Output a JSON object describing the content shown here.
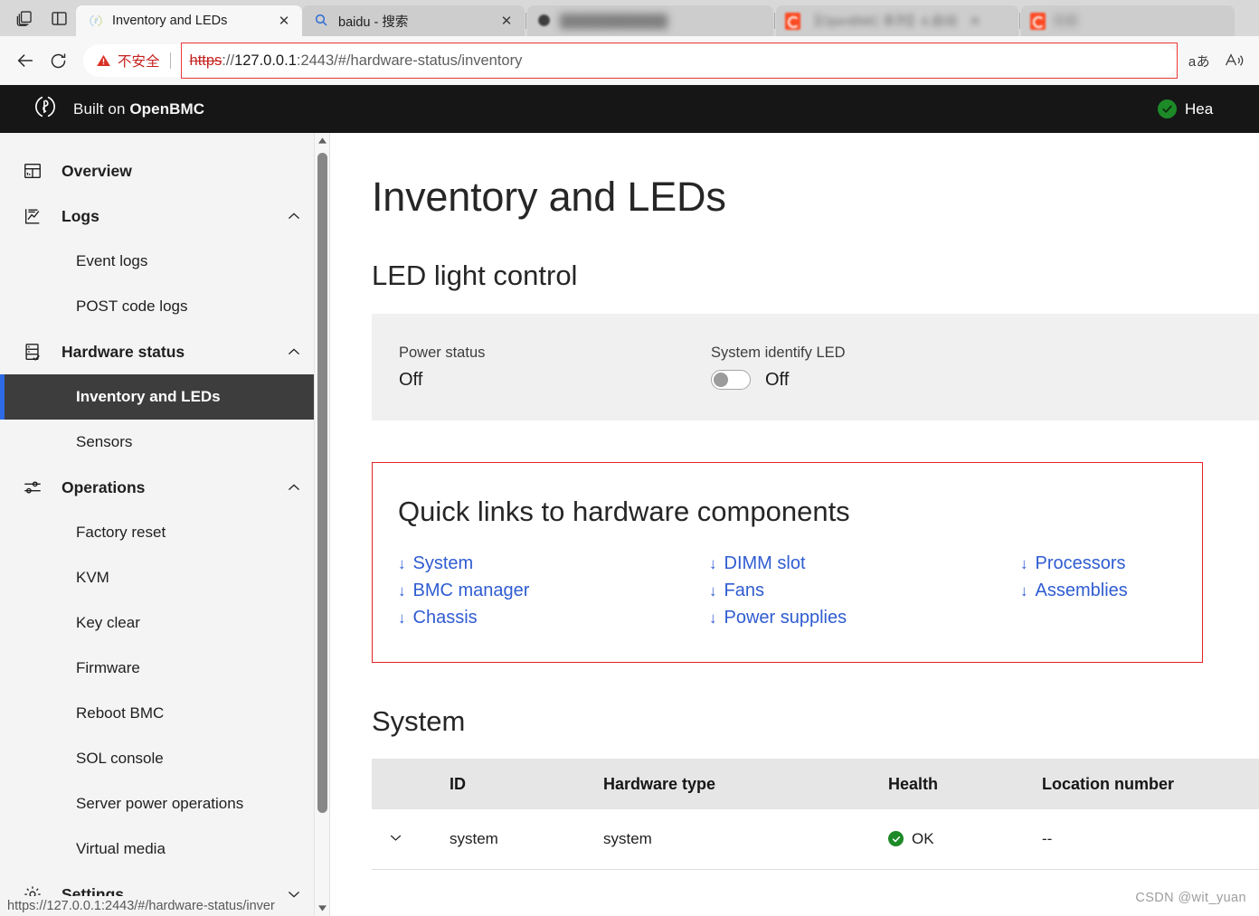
{
  "browser": {
    "chrome_buttons": [
      {
        "name": "tab-actions-icon"
      },
      {
        "name": "split-screen-icon"
      }
    ],
    "tabs": [
      {
        "title": "Inventory and LEDs",
        "favicon": "openbmc-icon",
        "active": true,
        "close_label": "✕"
      },
      {
        "title": "baidu - 搜索",
        "favicon": "search-icon",
        "active": false,
        "close_label": "✕"
      },
      {
        "title": "【OpenBMC 系列】4.启动",
        "favicon": "redacted-icon",
        "active": false,
        "close_label": "✕"
      },
      {
        "title": "答案",
        "favicon": "redacted-icon",
        "active": false,
        "close_label": "✕"
      }
    ],
    "toolbar": {
      "back_label": "←",
      "reload_label": "⟳",
      "security_warning": "不安全",
      "url_scheme": "https",
      "url_sep": "://",
      "url_host": "127.0.0.1",
      "url_port": ":2443",
      "url_path": "/#/hardware-status/inventory",
      "translate_label": "aあ",
      "read_aloud_label": "A"
    }
  },
  "app": {
    "header": {
      "brand_prefix": "Built on ",
      "brand_name": "OpenBMC",
      "logo_icon": "openbmc-logo-icon",
      "health_status": "Hea",
      "health_icon": "check-circle-icon",
      "health_color": "#1d8a28"
    },
    "sidebar": {
      "items": [
        {
          "label": "Overview",
          "icon": "dashboard-icon",
          "level": "top",
          "expandable": false,
          "active": false
        },
        {
          "label": "Logs",
          "icon": "logs-chart-icon",
          "level": "top",
          "expandable": true,
          "chevron": "up",
          "active": false
        },
        {
          "label": "Event logs",
          "icon": "",
          "level": "sub",
          "expandable": false,
          "active": false
        },
        {
          "label": "POST code logs",
          "icon": "",
          "level": "sub",
          "expandable": false,
          "active": false
        },
        {
          "label": "Hardware status",
          "icon": "server-check-icon",
          "level": "top",
          "expandable": true,
          "chevron": "up",
          "active": false
        },
        {
          "label": "Inventory and LEDs",
          "icon": "",
          "level": "sub",
          "expandable": false,
          "active": true
        },
        {
          "label": "Sensors",
          "icon": "",
          "level": "sub",
          "expandable": false,
          "active": false
        },
        {
          "label": "Operations",
          "icon": "sliders-icon",
          "level": "top",
          "expandable": true,
          "chevron": "up",
          "active": false
        },
        {
          "label": "Factory reset",
          "icon": "",
          "level": "sub",
          "expandable": false,
          "active": false
        },
        {
          "label": "KVM",
          "icon": "",
          "level": "sub",
          "expandable": false,
          "active": false
        },
        {
          "label": "Key clear",
          "icon": "",
          "level": "sub",
          "expandable": false,
          "active": false
        },
        {
          "label": "Firmware",
          "icon": "",
          "level": "sub",
          "expandable": false,
          "active": false
        },
        {
          "label": "Reboot BMC",
          "icon": "",
          "level": "sub",
          "expandable": false,
          "active": false
        },
        {
          "label": "SOL console",
          "icon": "",
          "level": "sub",
          "expandable": false,
          "active": false
        },
        {
          "label": "Server power operations",
          "icon": "",
          "level": "sub",
          "expandable": false,
          "active": false
        },
        {
          "label": "Virtual media",
          "icon": "",
          "level": "sub",
          "expandable": false,
          "active": false
        },
        {
          "label": "Settings",
          "icon": "gear-icon",
          "level": "top",
          "expandable": true,
          "chevron": "down",
          "active": false
        }
      ],
      "status_link": "https://127.0.0.1:2443/#/hardware-status/inver"
    },
    "main": {
      "page_title": "Inventory and LEDs",
      "led_section": {
        "heading": "LED light control",
        "power_status_label": "Power status",
        "power_status_value": "Off",
        "identify_label": "System identify LED",
        "identify_value": "Off",
        "identify_toggle_on": false
      },
      "quick_links": {
        "heading": "Quick links to hardware components",
        "arrow_glyph": "↓",
        "border_color": "#e32222",
        "link_color": "#2f5cd1",
        "columns": [
          [
            "System",
            "BMC manager",
            "Chassis"
          ],
          [
            "DIMM slot",
            "Fans",
            "Power supplies"
          ],
          [
            "Processors",
            "Assemblies"
          ]
        ]
      },
      "system_section": {
        "heading": "System",
        "columns": [
          "",
          "ID",
          "Hardware type",
          "Health",
          "Location number"
        ],
        "rows": [
          {
            "expand_glyph": "⌄",
            "id": "system",
            "hardware_type": "system",
            "health": "OK",
            "health_icon": "check-circle-icon",
            "location_number": "--"
          }
        ]
      },
      "watermark": "CSDN @wit_yuan"
    }
  }
}
